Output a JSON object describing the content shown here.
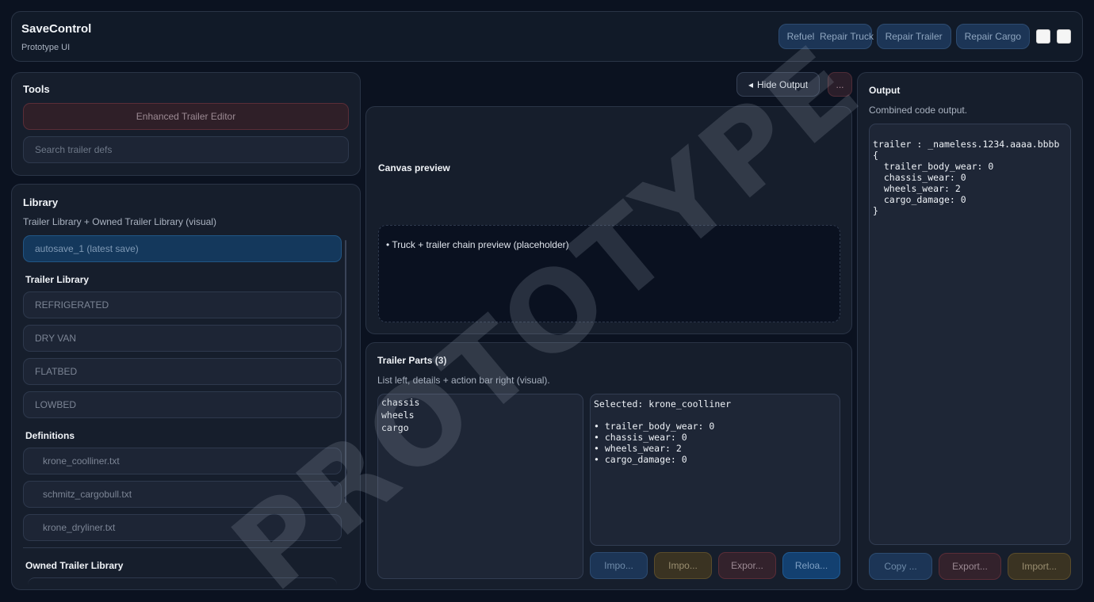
{
  "header": {
    "title": "SaveControl",
    "subtitle": "Prototype UI",
    "buttons": [
      "Refuel",
      "Repair Truck",
      "Repair Trailer",
      "Repair Cargo"
    ]
  },
  "tools": {
    "title": "Tools",
    "editor_button": "Enhanced Trailer Editor",
    "search_placeholder": "Search trailer defs"
  },
  "library": {
    "title": "Library",
    "subtitle": "Trailer Library + Owned Trailer Library (visual)",
    "selected_save": "autosave_1 (latest save)",
    "trailer_library_heading": "Trailer Library",
    "trailer_types": [
      "REFRIGERATED",
      "DRY VAN",
      "FLATBED",
      "LOWBED"
    ],
    "definitions_heading": "Definitions",
    "definitions": [
      "krone_coolliner.txt",
      "schmitz_cargobull.txt",
      "krone_dryliner.txt"
    ],
    "owned_heading": "Owned Trailer Library"
  },
  "toolbar": {
    "hide_output": "Hide Output",
    "hide_output_icon": "◂",
    "more": "..."
  },
  "canvas": {
    "title": "Canvas preview",
    "placeholder": "• Truck + trailer chain preview (placeholder)"
  },
  "parts": {
    "title": "Trailer Parts (3)",
    "subtitle": "List left, details + action bar right (visual).",
    "items": [
      "chassis",
      "wheels",
      "cargo"
    ],
    "detail": "Selected: krone_coolliner\n\n• trailer_body_wear: 0\n• chassis_wear: 0\n• wheels_wear: 2\n• cargo_damage: 0",
    "actions": [
      "Impo...",
      "Impo...",
      "Expor...",
      "Reloa..."
    ]
  },
  "output": {
    "title": "Output",
    "subtitle": "Combined code output.",
    "code": "trailer : _nameless.1234.aaaa.bbbb\n{\n  trailer_body_wear: 0\n  chassis_wear: 0\n  wheels_wear: 2\n  cargo_damage: 0\n}",
    "actions": [
      "Copy ...",
      "Export...",
      "Import..."
    ]
  },
  "watermark": "PROTOTYPE",
  "colors": {
    "background": "#0b1220",
    "panel": "#161e2c",
    "accent_blue": "#1c3556",
    "accent_red": "#2f1f28",
    "accent_olive": "#3a3322"
  }
}
